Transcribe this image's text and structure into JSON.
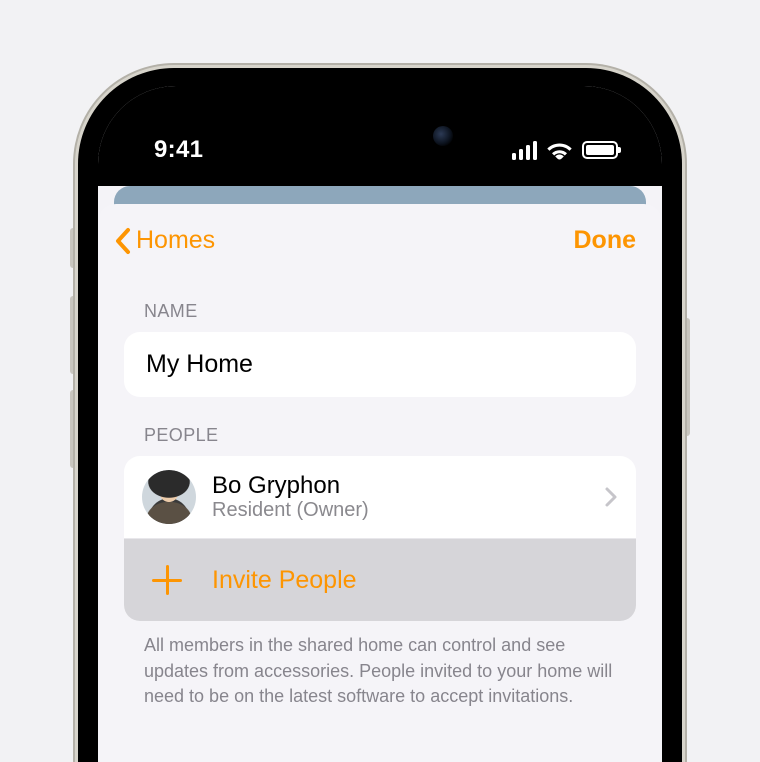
{
  "status": {
    "time": "9:41"
  },
  "nav": {
    "back": "Homes",
    "done": "Done"
  },
  "sections": {
    "name_label": "NAME",
    "people_label": "PEOPLE"
  },
  "home": {
    "name": "My Home"
  },
  "people": [
    {
      "name": "Bo Gryphon",
      "role": "Resident (Owner)"
    }
  ],
  "invite": {
    "label": "Invite People"
  },
  "footer": "All members in the shared home can control and see updates from accessories. People invited to your home will need to be on the latest software to accept invitations."
}
